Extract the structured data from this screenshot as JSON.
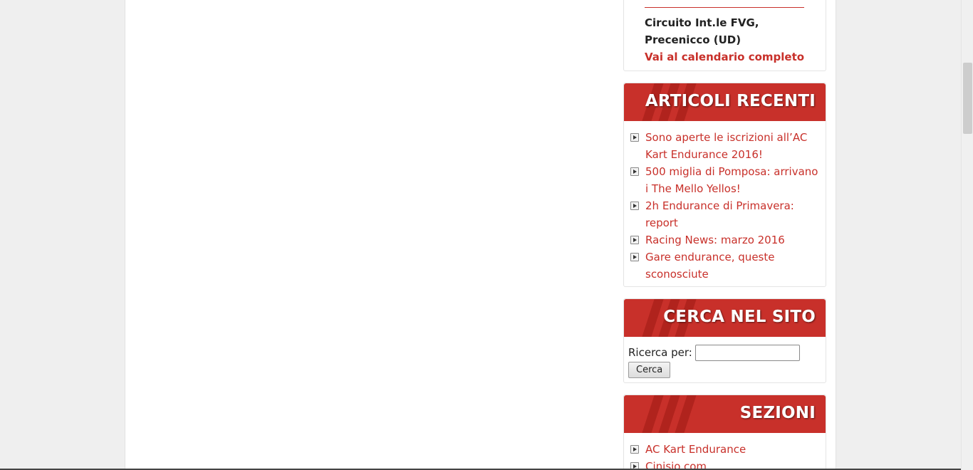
{
  "event": {
    "location": "Circuito Int.le FVG, Precenicco (UD)",
    "calendar_link": "Vai al calendario completo"
  },
  "recent": {
    "title": "ARTICOLI RECENTI",
    "items": [
      "Sono aperte le iscrizioni all’AC Kart Endurance 2016!",
      "500 miglia di Pomposa: arrivano i The Mello Yellos!",
      "2h Endurance di Primavera: report",
      "Racing News: marzo 2016",
      "Gare endurance, queste sconosciute"
    ]
  },
  "search": {
    "title": "CERCA NEL SITO",
    "label": "Ricerca per:",
    "value": "",
    "button": "Cerca"
  },
  "sections": {
    "title": "SEZIONI",
    "items": [
      "AC Kart Endurance",
      "Cinisio.com"
    ]
  },
  "colors": {
    "accent": "#c8302a",
    "accent_dark": "#b0231d"
  }
}
